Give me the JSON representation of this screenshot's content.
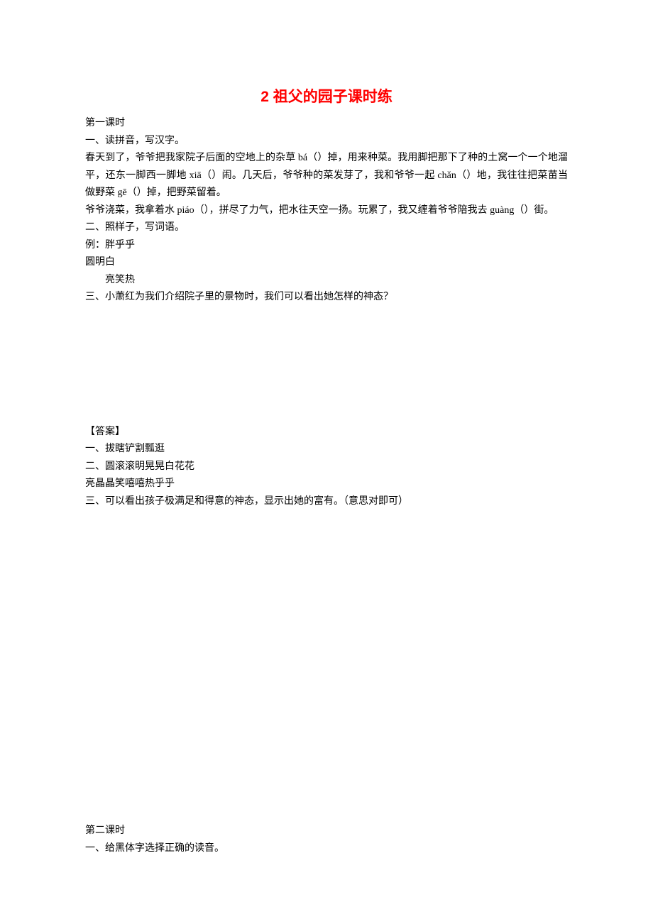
{
  "title": "2 祖父的园子课时练",
  "lesson1": {
    "heading": "第一课时",
    "q1_heading": "一、读拼音，写汉字。",
    "q1_p1": "春天到了，爷爷把我家院子后面的空地上的杂草 bá（）掉，用来种菜。我用脚把那下了种的土窝一个一个地溜平，还东一脚西一脚地 xiā（）闹。几天后，爷爷种的菜发芽了，我和爷爷一起 chǎn（）地，我往往把菜苗当做野菜 gē（）掉，把野菜留着。",
    "q1_p2": "爷爷浇菜，我拿着水 piáo（），拼尽了力气，把水往天空一扬。玩累了，我又缠着爷爷陪我去 guàng（）街。",
    "q2_heading": "二、照样子，写词语。",
    "q2_l1": "例：胖乎乎",
    "q2_l2": "圆明白",
    "q2_l3": "亮笑热",
    "q3_heading": "三、小萧红为我们介绍院子里的景物时，我们可以看出她怎样的神态？"
  },
  "answers": {
    "heading": "【答案】",
    "a1": "一、拔瞎铲割瓢逛",
    "a2_l1": "二、圆滚滚明晃晃白花花",
    "a2_l2": "亮晶晶笑嘻嘻热乎乎",
    "a3": "三、可以看出孩子极满足和得意的神态，显示出她的富有。（意思对即可）"
  },
  "lesson2": {
    "heading": "第二课时",
    "q1_heading": "一、给黑体字选择正确的读音。"
  }
}
